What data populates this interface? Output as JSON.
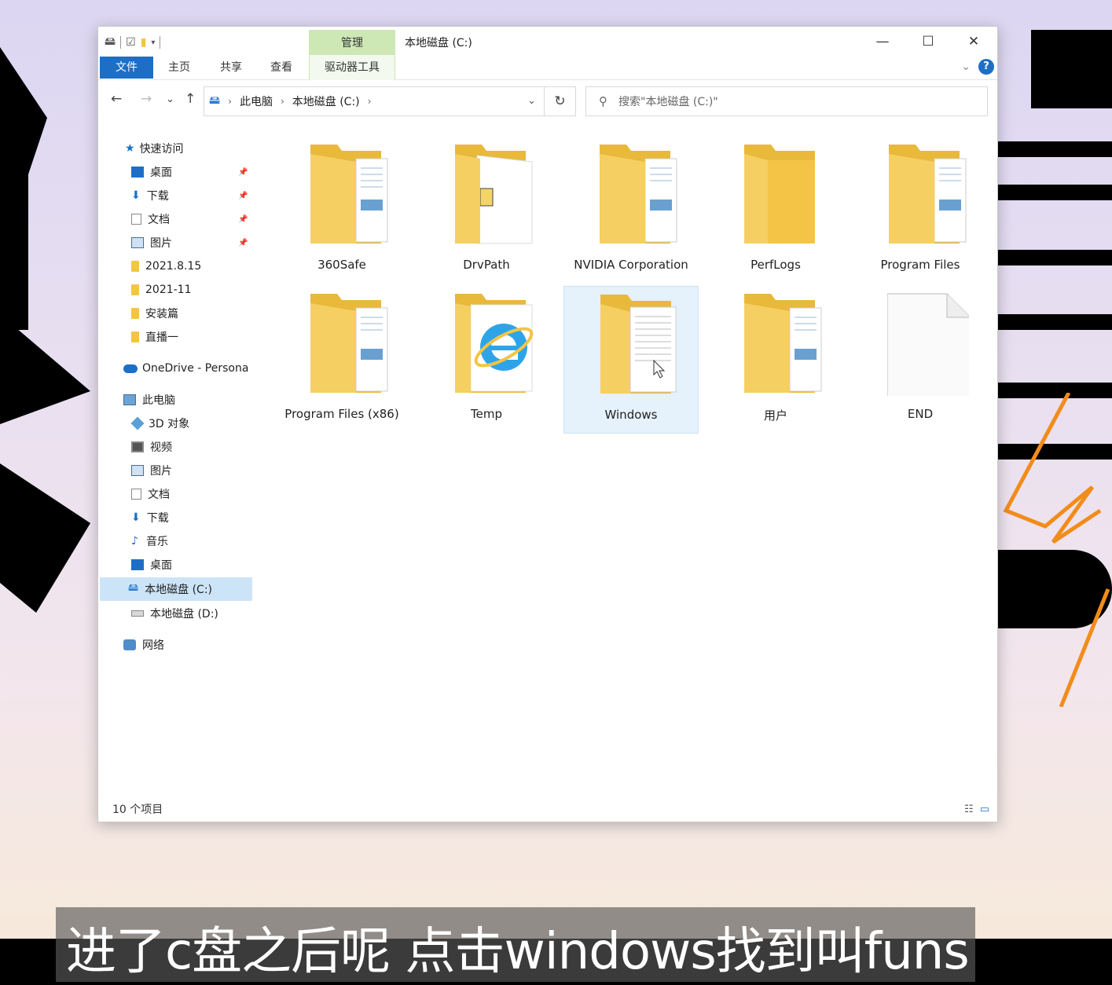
{
  "window": {
    "title": "本地磁盘 (C:)",
    "context_tab": "管理",
    "context_subtab": "驱动器工具",
    "minimize": "—",
    "maximize": "☐",
    "close": "✕"
  },
  "ribbon": {
    "tabs": [
      "文件",
      "主页",
      "共享",
      "查看"
    ],
    "expand": "⌄",
    "help": "?"
  },
  "nav": {
    "back": "←",
    "forward": "→",
    "recent": "⌄",
    "up": "↑",
    "breadcrumb": [
      "此电脑",
      "本地磁盘 (C:)"
    ],
    "refresh": "↻",
    "search_placeholder": "搜索\"本地磁盘 (C:)\""
  },
  "sidebar": {
    "items": [
      {
        "label": "快速访问",
        "icon": "star-icon"
      },
      {
        "label": "桌面",
        "icon": "desktop-icon",
        "pinned": true
      },
      {
        "label": "下载",
        "icon": "download-icon",
        "pinned": true
      },
      {
        "label": "文档",
        "icon": "document-icon",
        "pinned": true
      },
      {
        "label": "图片",
        "icon": "picture-icon",
        "pinned": true
      },
      {
        "label": "2021.8.15",
        "icon": "folder-icon"
      },
      {
        "label": "2021-11",
        "icon": "folder-icon"
      },
      {
        "label": "安装篇",
        "icon": "folder-icon"
      },
      {
        "label": "直播一",
        "icon": "folder-icon"
      },
      {
        "label": "OneDrive - Persona",
        "icon": "cloud-icon"
      },
      {
        "label": "此电脑",
        "icon": "computer-icon"
      },
      {
        "label": "3D 对象",
        "icon": "cube-icon"
      },
      {
        "label": "视频",
        "icon": "video-icon"
      },
      {
        "label": "图片",
        "icon": "picture-icon"
      },
      {
        "label": "文档",
        "icon": "document-icon"
      },
      {
        "label": "下载",
        "icon": "download-icon"
      },
      {
        "label": "音乐",
        "icon": "music-icon"
      },
      {
        "label": "桌面",
        "icon": "desktop-icon"
      },
      {
        "label": "本地磁盘 (C:)",
        "icon": "drive-icon",
        "selected": true
      },
      {
        "label": "本地磁盘 (D:)",
        "icon": "drive-icon"
      },
      {
        "label": "网络",
        "icon": "network-icon"
      }
    ],
    "pin_glyph": "📌"
  },
  "files": [
    {
      "name": "360Safe",
      "type": "folder-docs"
    },
    {
      "name": "DrvPath",
      "type": "folder-open"
    },
    {
      "name": "NVIDIA Corporation",
      "type": "folder-docs"
    },
    {
      "name": "PerfLogs",
      "type": "folder-empty"
    },
    {
      "name": "Program Files",
      "type": "folder-docs"
    },
    {
      "name": "Program Files (x86)",
      "type": "folder-docs"
    },
    {
      "name": "Temp",
      "type": "folder-ie"
    },
    {
      "name": "Windows",
      "type": "folder-papers",
      "selected": true
    },
    {
      "name": "用户",
      "type": "folder-docs"
    },
    {
      "name": "END",
      "type": "file-blank"
    }
  ],
  "status": {
    "item_count": "10 个项目"
  },
  "subtitle": "进了c盘之后呢 点击windows找到叫funs",
  "colors": {
    "accent": "#1d6fc6",
    "selection": "#cce4f7",
    "context_tab": "#cde8b4",
    "folder": "#f3c445"
  }
}
